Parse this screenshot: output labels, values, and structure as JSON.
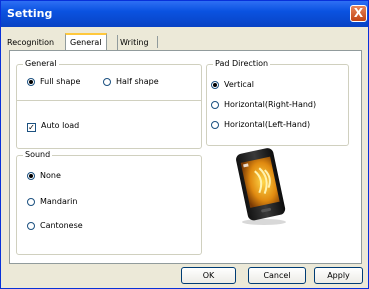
{
  "window": {
    "title": "Setting",
    "close_glyph": "X"
  },
  "tabs": [
    {
      "label": "Recognition"
    },
    {
      "label": "General"
    },
    {
      "label": "Writing"
    }
  ],
  "general": {
    "legend": "General",
    "options": [
      {
        "label": "Full shape",
        "selected": true
      },
      {
        "label": "Half shape",
        "selected": false
      }
    ],
    "auto_load": {
      "label": "Auto load",
      "checked": true
    }
  },
  "sound": {
    "legend": "Sound",
    "options": [
      {
        "label": "None",
        "selected": true
      },
      {
        "label": "Mandarin",
        "selected": false
      },
      {
        "label": "Cantonese",
        "selected": false
      }
    ]
  },
  "pad_direction": {
    "legend": "Pad Direction",
    "options": [
      {
        "label": "Vertical",
        "selected": true
      },
      {
        "label": "Horizontal(Right-Hand)",
        "selected": false
      },
      {
        "label": "Horizontal(Left-Hand)",
        "selected": false
      }
    ]
  },
  "buttons": {
    "ok": "OK",
    "cancel": "Cancel",
    "apply": "Apply"
  },
  "colors": {
    "titlebar": "#0a52e0",
    "face": "#ece9d8",
    "close": "#d9572a"
  },
  "icons": [
    "close-icon",
    "phone-illustration"
  ]
}
